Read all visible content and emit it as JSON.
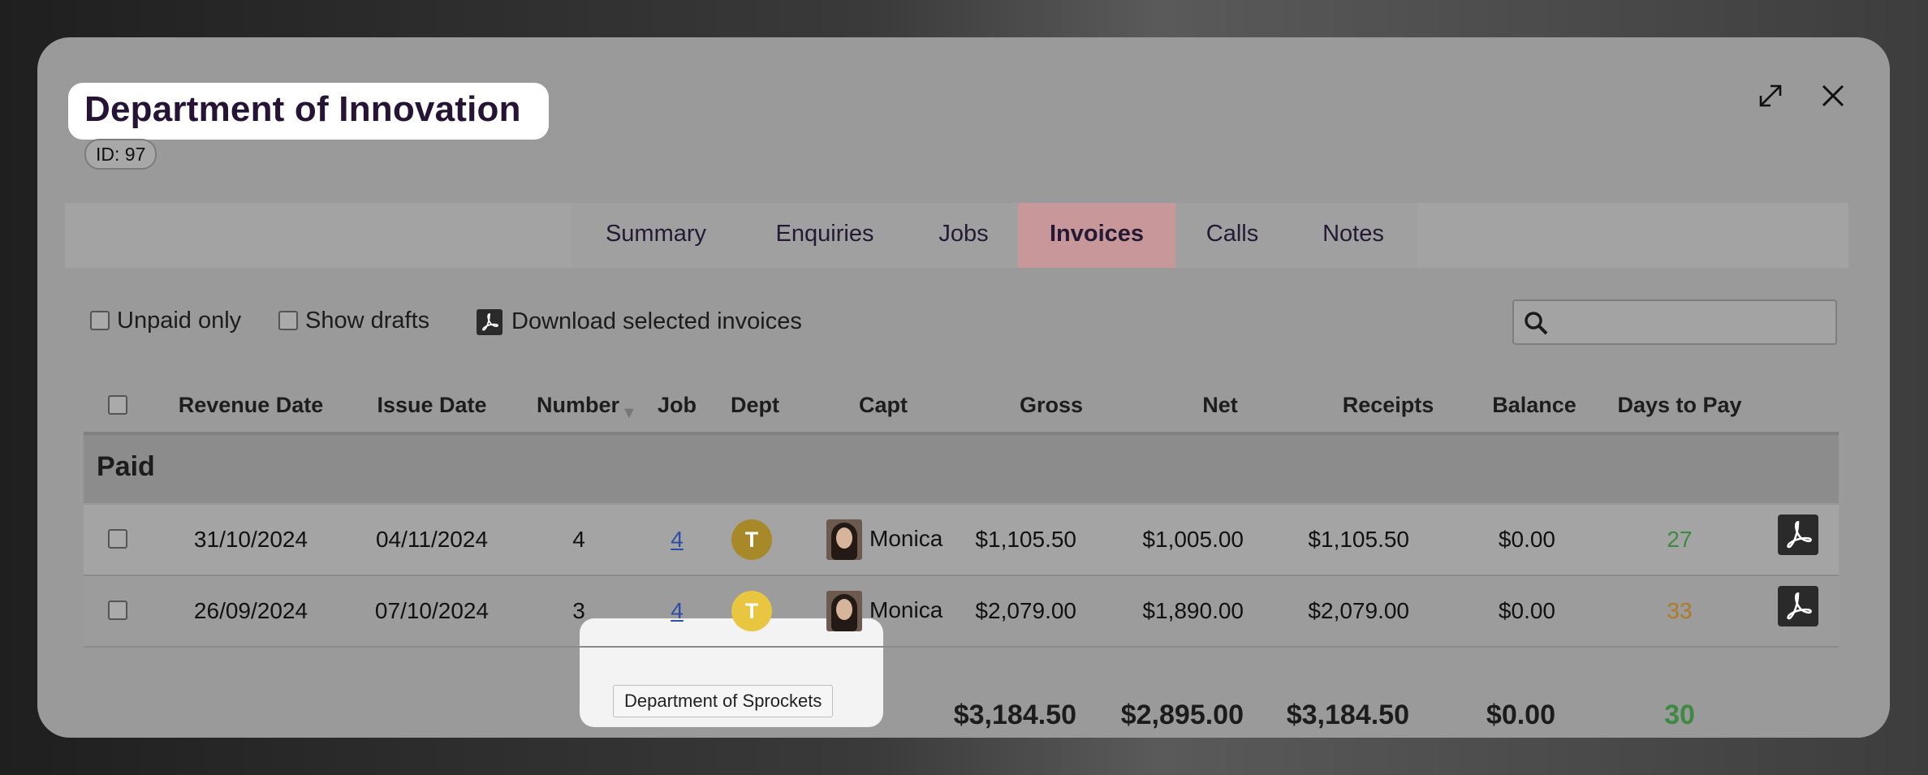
{
  "modal": {
    "title": "Department of Innovation",
    "id_badge": "ID: 97"
  },
  "tabs": [
    {
      "label": "Summary"
    },
    {
      "label": "Enquiries"
    },
    {
      "label": "Jobs"
    },
    {
      "label": "Invoices",
      "active": true
    },
    {
      "label": "Calls"
    },
    {
      "label": "Notes"
    }
  ],
  "toolbar": {
    "unpaid_only": "Unpaid only",
    "show_drafts": "Show drafts",
    "download": "Download selected invoices"
  },
  "table": {
    "headers": {
      "revenue_date": "Revenue Date",
      "issue_date": "Issue Date",
      "number": "Number",
      "job": "Job",
      "dept": "Dept",
      "capt": "Capt",
      "gross": "Gross",
      "net": "Net",
      "receipts": "Receipts",
      "balance": "Balance",
      "days_to_pay": "Days to Pay"
    },
    "group_label": "Paid",
    "rows": [
      {
        "revenue_date": "31/10/2024",
        "issue_date": "04/11/2024",
        "number": "4",
        "job": "4",
        "dept_initial": "T",
        "capt": "Monica",
        "gross": "$1,105.50",
        "net": "$1,005.00",
        "receipts": "$1,105.50",
        "balance": "$0.00",
        "days_to_pay": "27"
      },
      {
        "revenue_date": "26/09/2024",
        "issue_date": "07/10/2024",
        "number": "3",
        "job": "4",
        "dept_initial": "T",
        "capt": "Monica",
        "gross": "$2,079.00",
        "net": "$1,890.00",
        "receipts": "$2,079.00",
        "balance": "$0.00",
        "days_to_pay": "33"
      }
    ],
    "totals": {
      "gross": "$3,184.50",
      "net": "$2,895.00",
      "receipts": "$3,184.50",
      "balance": "$0.00",
      "days_to_pay": "30"
    }
  },
  "tooltip": "Department of Sprockets",
  "colors": {
    "active_tab": "#c79799",
    "title": "#251436",
    "days_good": "#3f8a43",
    "days_warn": "#b07a25",
    "dept_row1": "#a8892a",
    "dept_row2": "#e8c640"
  }
}
